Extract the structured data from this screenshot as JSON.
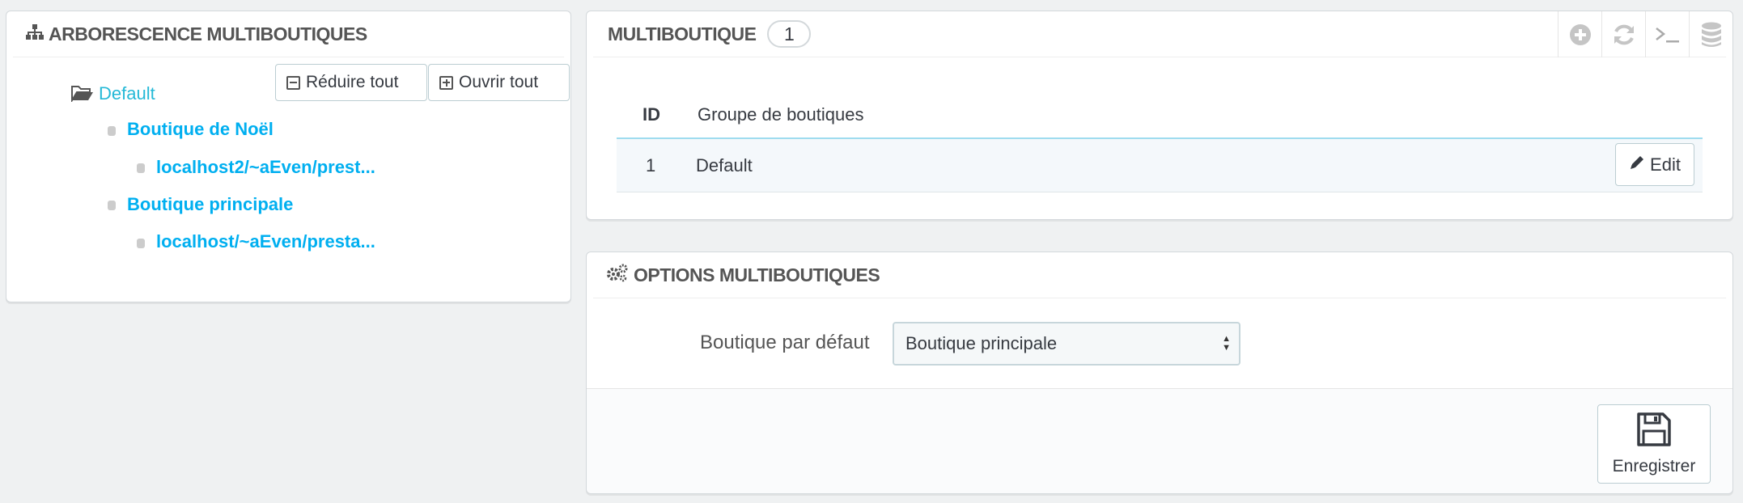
{
  "tree_panel": {
    "title": "ARBORESCENCE MULTIBOUTIQUES",
    "collapse_label": "Réduire tout",
    "expand_label": "Ouvrir tout",
    "nodes": [
      {
        "label": "Default"
      },
      {
        "label": "Boutique de Noël"
      },
      {
        "label": "localhost2/~aEven/prest..."
      },
      {
        "label": "Boutique principale"
      },
      {
        "label": "localhost/~aEven/presta..."
      }
    ]
  },
  "multi_panel": {
    "title": "MULTIBOUTIQUE",
    "count": "1",
    "toolbar_icons": [
      "add-icon",
      "refresh-icon",
      "terminal-icon",
      "database-icon"
    ],
    "columns": {
      "id": "ID",
      "group": "Groupe de boutiques"
    },
    "rows": [
      {
        "id": "1",
        "name": "Default",
        "action": "Edit"
      }
    ]
  },
  "options_panel": {
    "title": "OPTIONS MULTIBOUTIQUES",
    "field_label": "Boutique par défaut",
    "select_value": "Boutique principale",
    "save_label": "Enregistrer"
  },
  "colors": {
    "link": "#25b9d7",
    "link_bold": "#00aff0",
    "background": "#eff1f2"
  }
}
